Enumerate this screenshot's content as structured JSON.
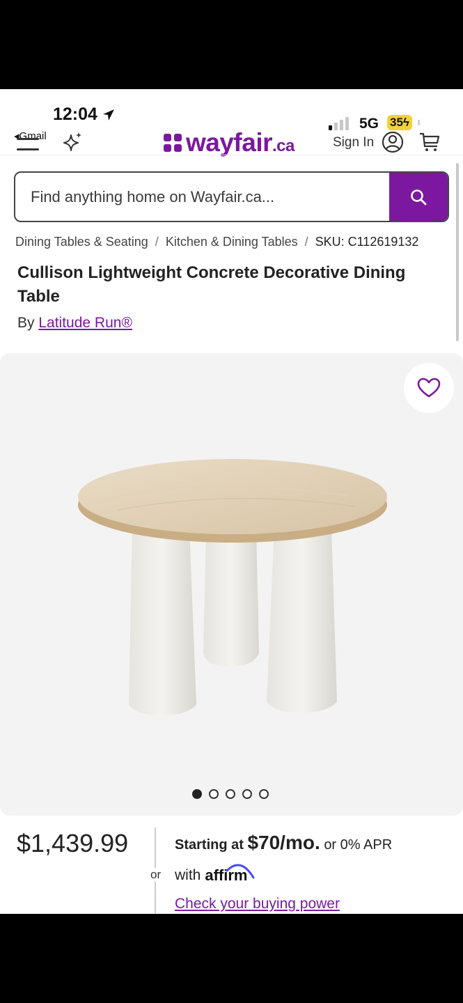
{
  "status_bar": {
    "time": "12:04",
    "back_app": "Gmail",
    "network": "5G",
    "battery": "35"
  },
  "header": {
    "logo_main": "wayfair",
    "logo_suffix": ".ca",
    "sign_in": "Sign In"
  },
  "search": {
    "placeholder": "Find anything home on Wayfair.ca..."
  },
  "breadcrumb": {
    "items": [
      "Dining Tables & Seating",
      "Kitchen & Dining Tables"
    ],
    "separator": "/",
    "sku": "SKU: C112619132"
  },
  "product": {
    "title": "Cullison Lightweight Concrete Decorative Dining Table",
    "by_label": "By",
    "brand": "Latitude Run®",
    "image_count": 5,
    "active_image": 1
  },
  "pricing": {
    "price": "$1,439.99",
    "or_label": "or",
    "starting_at": "Starting at",
    "monthly": "$70/mo.",
    "apr": "or 0% APR",
    "with_label": "with",
    "financer": "affirm",
    "check_link": "Check your buying power"
  },
  "colors": {
    "brand_purple": "#7b189f"
  }
}
